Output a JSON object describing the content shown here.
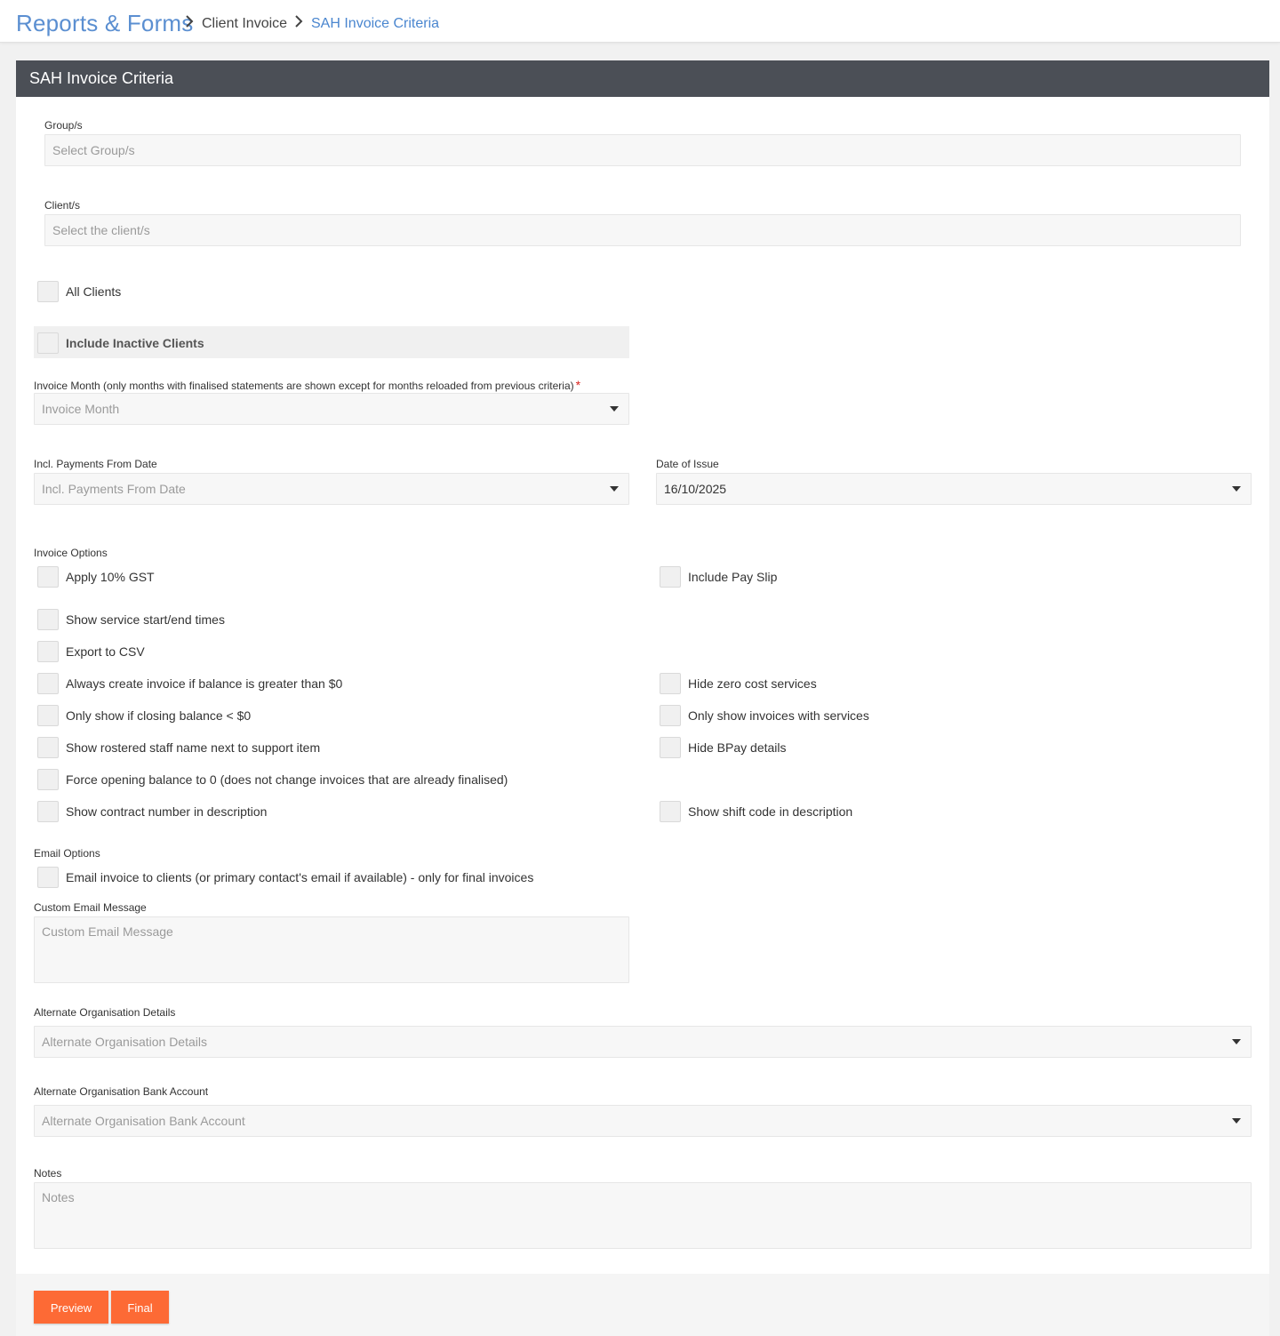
{
  "breadcrumb": {
    "root": "Reports & Forms",
    "middle": "Client Invoice",
    "current": "SAH Invoice Criteria"
  },
  "panel": {
    "title": "SAH Invoice Criteria"
  },
  "groups": {
    "label": "Group/s",
    "placeholder": "Select Group/s"
  },
  "clients": {
    "label": "Client/s",
    "placeholder": "Select the client/s"
  },
  "all_clients": {
    "label": "All Clients",
    "checked": false
  },
  "include_inactive": {
    "label": "Include Inactive Clients",
    "checked": false
  },
  "invoice_month": {
    "label": "Invoice Month (only months with finalised statements are shown except for months reloaded from previous criteria)",
    "required_mark": "*",
    "placeholder": "Invoice Month"
  },
  "payments_from": {
    "label": "Incl. Payments From Date",
    "placeholder": "Incl. Payments From Date"
  },
  "date_of_issue": {
    "label": "Date of Issue",
    "value": "16/10/2025"
  },
  "invoice_options": {
    "label": "Invoice Options",
    "apply_gst": "Apply 10% GST",
    "include_pay_slip": "Include Pay Slip",
    "show_times": "Show service start/end times",
    "export_csv": "Export to CSV",
    "always_create": "Always create invoice if balance is greater than $0",
    "hide_zero_cost": "Hide zero cost services",
    "only_closing": "Only show if closing balance < $0",
    "only_with_services": "Only show invoices with services",
    "show_staff_name": "Show rostered staff name next to support item",
    "hide_bpay": "Hide BPay details",
    "force_opening": "Force opening balance to 0 (does not change invoices that are already finalised)",
    "show_contract": "Show contract number in description",
    "show_shift_code": "Show shift code in description"
  },
  "email_options": {
    "label": "Email Options",
    "email_invoice": "Email invoice to clients (or primary contact's email if available) - only for final invoices",
    "custom_label": "Custom Email Message",
    "custom_placeholder": "Custom Email Message"
  },
  "alt_org": {
    "label": "Alternate Organisation Details",
    "placeholder": "Alternate Organisation Details"
  },
  "alt_bank": {
    "label": "Alternate Organisation Bank Account",
    "placeholder": "Alternate Organisation Bank Account"
  },
  "notes": {
    "label": "Notes",
    "placeholder": "Notes"
  },
  "buttons": {
    "preview": "Preview",
    "final": "Final"
  },
  "colors": {
    "accent": "#fd6a35",
    "header": "#4b4f56",
    "link": "#4a86cf",
    "required": "#d9231d"
  }
}
